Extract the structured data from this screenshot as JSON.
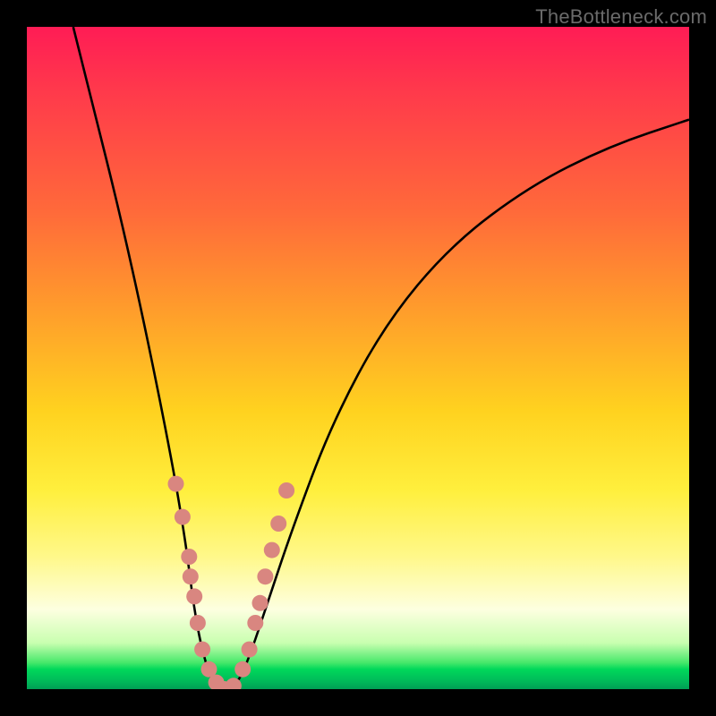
{
  "watermark": "TheBottleneck.com",
  "chart_data": {
    "type": "line",
    "title": "",
    "xlabel": "",
    "ylabel": "",
    "ylim": [
      0,
      100
    ],
    "background_gradient_stops": [
      {
        "pos": 0,
        "color": "#ff1c55"
      },
      {
        "pos": 28,
        "color": "#ff6a3a"
      },
      {
        "pos": 58,
        "color": "#ffd21f"
      },
      {
        "pos": 80,
        "color": "#fff88a"
      },
      {
        "pos": 96,
        "color": "#46e86a"
      },
      {
        "pos": 100,
        "color": "#009e55"
      }
    ],
    "series": [
      {
        "name": "bottleneck-curve",
        "x": [
          0.07,
          0.1,
          0.14,
          0.18,
          0.22,
          0.24,
          0.25,
          0.26,
          0.27,
          0.28,
          0.3,
          0.32,
          0.34,
          0.36,
          0.4,
          0.46,
          0.54,
          0.64,
          0.76,
          0.88,
          1.0
        ],
        "y": [
          100,
          88,
          72,
          54,
          34,
          22,
          14,
          8,
          4,
          1,
          0,
          1,
          6,
          12,
          24,
          40,
          55,
          67,
          76,
          82,
          86
        ]
      }
    ],
    "markers": {
      "name": "highlighted-points",
      "color": "#d98680",
      "points": [
        {
          "x": 0.225,
          "y": 31
        },
        {
          "x": 0.235,
          "y": 26
        },
        {
          "x": 0.245,
          "y": 20
        },
        {
          "x": 0.247,
          "y": 17
        },
        {
          "x": 0.253,
          "y": 14
        },
        {
          "x": 0.258,
          "y": 10
        },
        {
          "x": 0.265,
          "y": 6
        },
        {
          "x": 0.275,
          "y": 3
        },
        {
          "x": 0.286,
          "y": 1
        },
        {
          "x": 0.298,
          "y": 0
        },
        {
          "x": 0.312,
          "y": 0.5
        },
        {
          "x": 0.326,
          "y": 3
        },
        {
          "x": 0.336,
          "y": 6
        },
        {
          "x": 0.345,
          "y": 10
        },
        {
          "x": 0.352,
          "y": 13
        },
        {
          "x": 0.36,
          "y": 17
        },
        {
          "x": 0.37,
          "y": 21
        },
        {
          "x": 0.38,
          "y": 25
        },
        {
          "x": 0.392,
          "y": 30
        }
      ]
    }
  }
}
